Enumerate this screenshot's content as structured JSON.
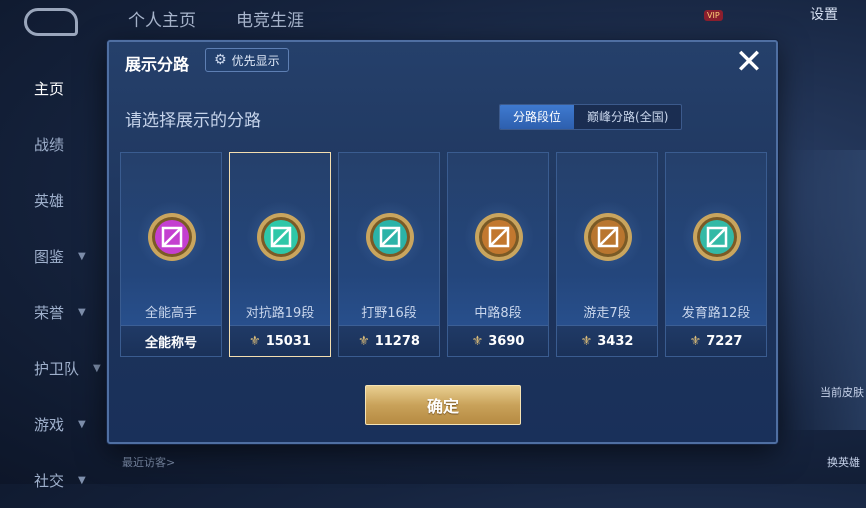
{
  "background": {
    "top_tabs": [
      "个人主页",
      "电竞生涯"
    ],
    "settings_label": "设置",
    "vip_label": "VIP",
    "sidebar": [
      "主页",
      "战绩",
      "英雄",
      "图鉴",
      "荣誉",
      "护卫队",
      "游戏",
      "社交"
    ],
    "recent_visitors": "最近访客>",
    "right_labels": [
      "换英雄",
      "当前皮肤"
    ]
  },
  "modal": {
    "title": "展示分路",
    "priority_label": "优先显示",
    "subtitle": "请选择展示的分路",
    "segments": [
      "分路段位",
      "巅峰分路(全国)"
    ],
    "active_segment": 0,
    "close_label": "✕",
    "confirm_label": "确定",
    "lanes": [
      {
        "name": "全能高手",
        "foot": "全能称号",
        "points_icon": false,
        "badge_color": "#c43fd0",
        "selected": false
      },
      {
        "name": "对抗路19段",
        "foot": "15031",
        "points_icon": true,
        "badge_color": "#2fc7a8",
        "selected": true
      },
      {
        "name": "打野16段",
        "foot": "11278",
        "points_icon": true,
        "badge_color": "#2cb3a8",
        "selected": false
      },
      {
        "name": "中路8段",
        "foot": "3690",
        "points_icon": true,
        "badge_color": "#c2782f",
        "selected": false
      },
      {
        "name": "游走7段",
        "foot": "3432",
        "points_icon": true,
        "badge_color": "#b9762f",
        "selected": false
      },
      {
        "name": "发育路12段",
        "foot": "7227",
        "points_icon": true,
        "badge_color": "#33b9a6",
        "selected": false
      }
    ]
  },
  "colors": {
    "accent": "#2d5fae",
    "gold": "#c9a25a",
    "selected_border": "#f3deb0"
  }
}
